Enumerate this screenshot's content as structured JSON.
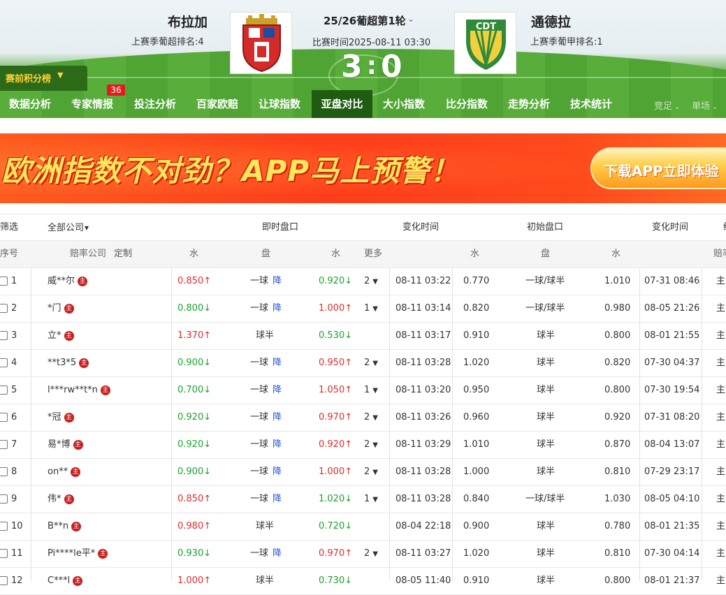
{
  "match": {
    "home": {
      "name": "布拉加",
      "rank": "上赛季葡超排名:4"
    },
    "away": {
      "name": "通德拉",
      "rank": "上赛季葡甲排名:1"
    },
    "round": "25/26葡超第1轮",
    "time": "比赛时间2025-08-11 03:30",
    "score_home": "3",
    "score_sep": ":",
    "score_away": "0",
    "away_crest_text": "CDT"
  },
  "points_button": "赛前积分榜",
  "nav": {
    "items": [
      "数据分析",
      "专家情报",
      "投注分析",
      "百家欧赔",
      "让球指数",
      "亚盘对比",
      "大小指数",
      "比分指数",
      "走势分析",
      "技术统计"
    ],
    "active": "亚盘对比",
    "badge": "36",
    "options": [
      "竞足",
      "单场"
    ]
  },
  "banner": {
    "text": "欧洲指数不对劲？APP马上预警！",
    "button": "下载APP立即体验"
  },
  "table": {
    "header1": {
      "filter": "筛选",
      "company_select": "全部公司",
      "live": "即时盘口",
      "change_time": "变化时间",
      "initial": "初始盘口",
      "change_time2": "变化时间",
      "extra": "统"
    },
    "header2": {
      "no": "序号",
      "company": "赔率公司",
      "custom": "定制",
      "water1": "水",
      "line": "盘",
      "water2": "水",
      "more": "更多",
      "init_water1": "水",
      "init_line": "盘",
      "init_water2": "水",
      "extra": "赔率"
    },
    "zhu_label": "主",
    "rows": [
      {
        "no": "1",
        "company": "威**尔",
        "w1": "0.850",
        "w1dir": "up",
        "line": "一球",
        "jiang": "降",
        "w2": "0.920",
        "w2dir": "down",
        "more": "2",
        "time": "08-11 03:22",
        "iw1": "0.770",
        "iline": "一球/球半",
        "iw2": "1.010",
        "itime": "07-31 08:46",
        "extra": "主"
      },
      {
        "no": "2",
        "company": "*门",
        "w1": "0.800",
        "w1dir": "down",
        "line": "一球",
        "jiang": "降",
        "w2": "1.000",
        "w2dir": "up",
        "more": "1",
        "time": "08-11 03:14",
        "iw1": "0.820",
        "iline": "一球/球半",
        "iw2": "0.980",
        "itime": "08-05 21:26",
        "extra": "主"
      },
      {
        "no": "3",
        "company": "立*",
        "w1": "1.370",
        "w1dir": "up",
        "line": "球半",
        "jiang": "",
        "w2": "0.530",
        "w2dir": "down",
        "more": "",
        "time": "08-11 03:17",
        "iw1": "0.910",
        "iline": "球半",
        "iw2": "0.800",
        "itime": "08-01 21:55",
        "extra": "主"
      },
      {
        "no": "4",
        "company": "**t3*5",
        "w1": "0.900",
        "w1dir": "down",
        "line": "一球",
        "jiang": "降",
        "w2": "0.950",
        "w2dir": "up",
        "more": "2",
        "time": "08-11 03:28",
        "iw1": "1.020",
        "iline": "球半",
        "iw2": "0.820",
        "itime": "07-30 04:37",
        "extra": "主"
      },
      {
        "no": "5",
        "company": "l***rw**t*n",
        "w1": "0.700",
        "w1dir": "down",
        "line": "一球",
        "jiang": "降",
        "w2": "1.050",
        "w2dir": "up",
        "more": "1",
        "time": "08-11 03:20",
        "iw1": "0.950",
        "iline": "球半",
        "iw2": "0.800",
        "itime": "07-30 19:54",
        "extra": "主"
      },
      {
        "no": "6",
        "company": "*冠",
        "w1": "0.920",
        "w1dir": "down",
        "line": "一球",
        "jiang": "降",
        "w2": "0.970",
        "w2dir": "up",
        "more": "2",
        "time": "08-11 03:26",
        "iw1": "0.960",
        "iline": "球半",
        "iw2": "0.920",
        "itime": "07-31 08:20",
        "extra": "主"
      },
      {
        "no": "7",
        "company": "易*博",
        "w1": "0.920",
        "w1dir": "down",
        "line": "一球",
        "jiang": "降",
        "w2": "0.920",
        "w2dir": "up",
        "more": "2",
        "time": "08-11 03:29",
        "iw1": "1.010",
        "iline": "球半",
        "iw2": "0.870",
        "itime": "08-04 13:07",
        "extra": "主"
      },
      {
        "no": "8",
        "company": "on**",
        "w1": "0.900",
        "w1dir": "down",
        "line": "一球",
        "jiang": "降",
        "w2": "1.000",
        "w2dir": "up",
        "more": "2",
        "time": "08-11 03:28",
        "iw1": "1.000",
        "iline": "球半",
        "iw2": "0.810",
        "itime": "07-29 23:17",
        "extra": "主"
      },
      {
        "no": "9",
        "company": "伟*",
        "w1": "0.850",
        "w1dir": "up",
        "line": "一球",
        "jiang": "降",
        "w2": "1.020",
        "w2dir": "down",
        "more": "1",
        "time": "08-11 03:28",
        "iw1": "0.840",
        "iline": "一球/球半",
        "iw2": "1.030",
        "itime": "08-05 04:10",
        "extra": "主"
      },
      {
        "no": "10",
        "company": "B**n",
        "w1": "0.980",
        "w1dir": "up",
        "line": "球半",
        "jiang": "",
        "w2": "0.720",
        "w2dir": "down",
        "more": "",
        "time": "08-04 22:18",
        "iw1": "0.900",
        "iline": "球半",
        "iw2": "0.780",
        "itime": "08-01 21:35",
        "extra": "主"
      },
      {
        "no": "11",
        "company": "Pi****le平*",
        "w1": "0.930",
        "w1dir": "down",
        "line": "一球",
        "jiang": "降",
        "w2": "0.970",
        "w2dir": "up",
        "more": "2",
        "time": "08-11 03:27",
        "iw1": "1.020",
        "iline": "球半",
        "iw2": "0.810",
        "itime": "07-30 04:14",
        "extra": "主"
      },
      {
        "no": "12",
        "company": "C***l",
        "w1": "1.000",
        "w1dir": "up",
        "line": "球半",
        "jiang": "",
        "w2": "0.730",
        "w2dir": "down",
        "more": "",
        "time": "08-05 11:40",
        "iw1": "0.910",
        "iline": "球半",
        "iw2": "0.800",
        "itime": "08-01 21:37",
        "extra": "主"
      }
    ]
  },
  "arrows": {
    "up": "↑",
    "down": "↓"
  },
  "colors": {
    "up": "#e32b2b",
    "down": "#1aa32e",
    "jiang": "#2b5ad6",
    "nav_active": "#1f5c12",
    "banner": "#ff3d1a"
  }
}
